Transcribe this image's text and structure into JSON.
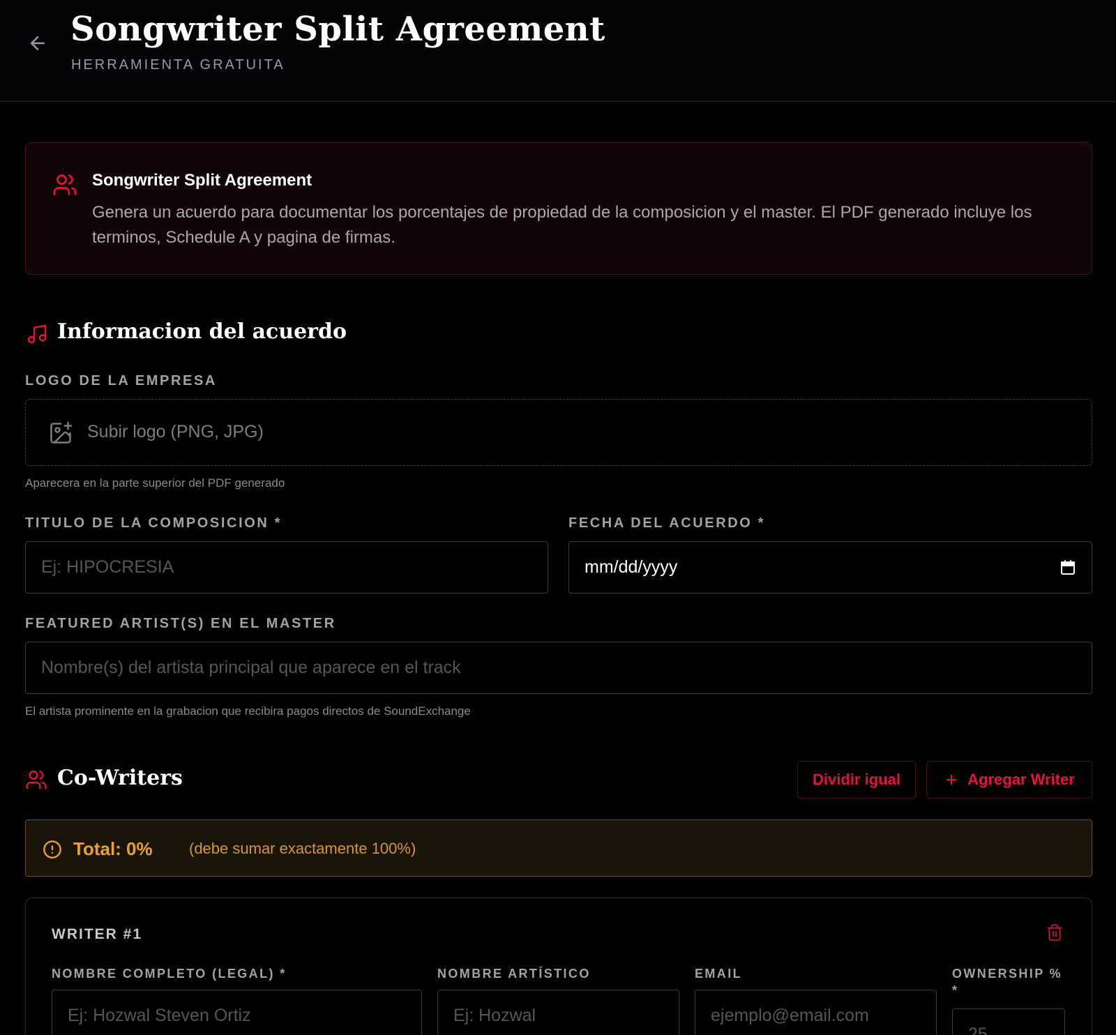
{
  "header": {
    "title": "Songwriter Split Agreement",
    "subtitle": "HERRAMIENTA GRATUITA"
  },
  "banner": {
    "title": "Songwriter Split Agreement",
    "text": "Genera un acuerdo para documentar los porcentajes de propiedad de la composicion y el master. El PDF generado incluye los terminos, Schedule A y pagina de firmas."
  },
  "agreement_section": {
    "title": "Informacion del acuerdo",
    "logo_label": "LOGO DE LA EMPRESA",
    "logo_upload_text": "Subir logo (PNG, JPG)",
    "logo_hint": "Aparecera en la parte superior del PDF generado",
    "composition_label": "TITULO DE LA COMPOSICION *",
    "composition_placeholder": "Ej: HIPOCRESIA",
    "date_label": "FECHA DEL ACUERDO *",
    "date_value": "mm/dd/yyyy",
    "featured_label": "FEATURED ARTIST(S) EN EL MASTER",
    "featured_placeholder": "Nombre(s) del artista principal que aparece en el track",
    "featured_hint": "El artista prominente en la grabacion que recibira pagos directos de SoundExchange"
  },
  "cowriters_section": {
    "title": "Co-Writers",
    "split_button": "Dividir igual",
    "add_button": "Agregar Writer",
    "total_label": "Total: 0%",
    "total_note": "(debe sumar exactamente 100%)"
  },
  "writers": [
    {
      "title": "WRITER #1",
      "legal_name_label": "NOMBRE COMPLETO (LEGAL) *",
      "legal_name_placeholder": "Ej: Hozwal Steven Ortiz",
      "artist_name_label": "NOMBRE ARTÍSTICO",
      "artist_name_placeholder": "Ej: Hozwal",
      "email_label": "EMAIL",
      "email_placeholder": "ejemplo@email.com",
      "ownership_label": "OWNERSHIP %",
      "ownership_required": "*",
      "ownership_placeholder": "25"
    }
  ],
  "colors": {
    "accent_red": "#e8103c",
    "warning_amber": "#e8a227",
    "background": "#000000"
  },
  "icons": {
    "back": "arrow-left-icon",
    "banner": "users-icon",
    "agreement": "music-note-icon",
    "upload": "image-plus-icon",
    "date": "calendar-icon",
    "cowriters": "users-icon",
    "add": "plus-icon",
    "warning": "alert-circle-icon",
    "delete": "trash-icon"
  }
}
